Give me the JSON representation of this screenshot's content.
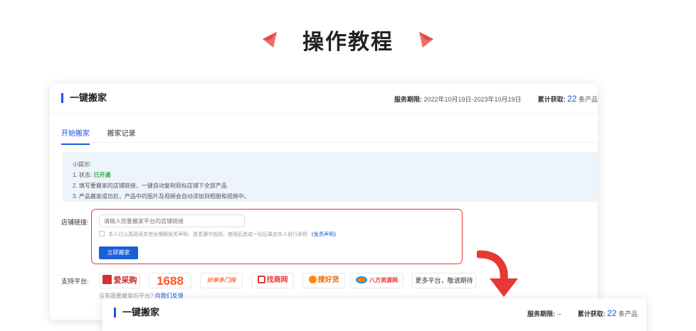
{
  "heading": {
    "title": "操作教程"
  },
  "main": {
    "title": "一键搬家",
    "service": {
      "period_label": "服务期限:",
      "period_value": "2022年10月19日-2023年10月19日",
      "obtained_label": "累计获取:",
      "obtained_count": "22",
      "obtained_unit": "条产品"
    },
    "tabs": [
      {
        "label": "开始搬家",
        "active": true
      },
      {
        "label": "搬家记录",
        "active": false
      }
    ],
    "tips": {
      "title": "小提示:",
      "line1_prefix": "1. 状态:",
      "line1_status": "已开通",
      "line2": "2. 填写要搬家的店铺链接，一键自动复制目标店铺下全部产品",
      "line3": "3. 产品搬家成功后，产品中的图片及视频会自动添加到相册和视频中。"
    },
    "store_link": {
      "label": "店铺链接:",
      "placeholder": "请输入您要搬家平台的店铺链接",
      "agree_text": "本人已认真阅读并完全理解免责声明、愿意遵守规则、使用后造成一切后果由本人自行承担",
      "agree_link": "《免责声明》",
      "button": "立即搬家"
    },
    "platforms": {
      "label": "支持平台:",
      "items": [
        "爱采购",
        "1688",
        "好单多门网",
        "找商网",
        "搜好货",
        "八方资源网",
        "更多平台，敬请期待"
      ],
      "feedback_text": "没有我要搬家的平台?",
      "feedback_link": "向我们反馈"
    }
  },
  "secondary": {
    "title": "一键搬家",
    "service": {
      "period_label": "服务期限:",
      "period_value": "--",
      "obtained_label": "累计获取:",
      "obtained_count": "22",
      "obtained_unit": "条产品"
    }
  },
  "colors": {
    "accent": "#1a56db",
    "highlight": "#e53935",
    "status_green": "#2eaa3a",
    "tips_bg": "#eef4fc"
  }
}
